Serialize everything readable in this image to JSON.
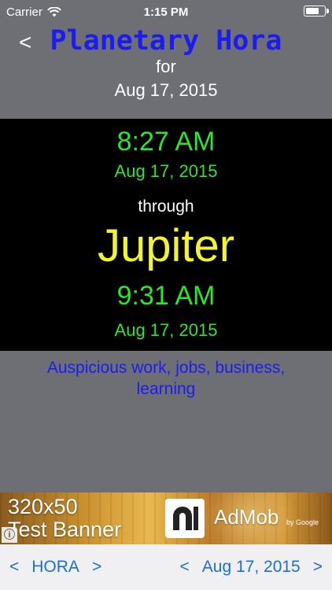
{
  "status_bar": {
    "carrier": "Carrier",
    "time": "1:15 PM"
  },
  "header": {
    "back_label": "<",
    "title": "Planetary Hora",
    "for_label": "for",
    "date": "Aug 17, 2015"
  },
  "hora": {
    "start_time": "8:27 AM",
    "start_date": "Aug 17, 2015",
    "through_label": "through",
    "planet": "Jupiter",
    "end_time": "9:31 AM",
    "end_date": "Aug 17, 2015"
  },
  "description": "Auspicious work, jobs, business, learning",
  "ad": {
    "line1": "320x50",
    "line2": "Test Banner",
    "brand": "AdMob",
    "by": "by Google",
    "info": "i"
  },
  "bottom_bar": {
    "left_prev": "<",
    "left_label": "HORA",
    "left_next": ">",
    "right_prev": "<",
    "right_label": "Aug 17, 2015",
    "right_next": ">"
  },
  "colors": {
    "background": "#6d6f75",
    "title": "#1c1cf0",
    "time_green": "#2ce52c",
    "planet_yellow": "#f4f42a",
    "nav_blue": "#1a6fd8"
  },
  "icons": [
    "wifi-icon",
    "battery-icon",
    "admob-logo-icon",
    "ad-info-icon"
  ]
}
